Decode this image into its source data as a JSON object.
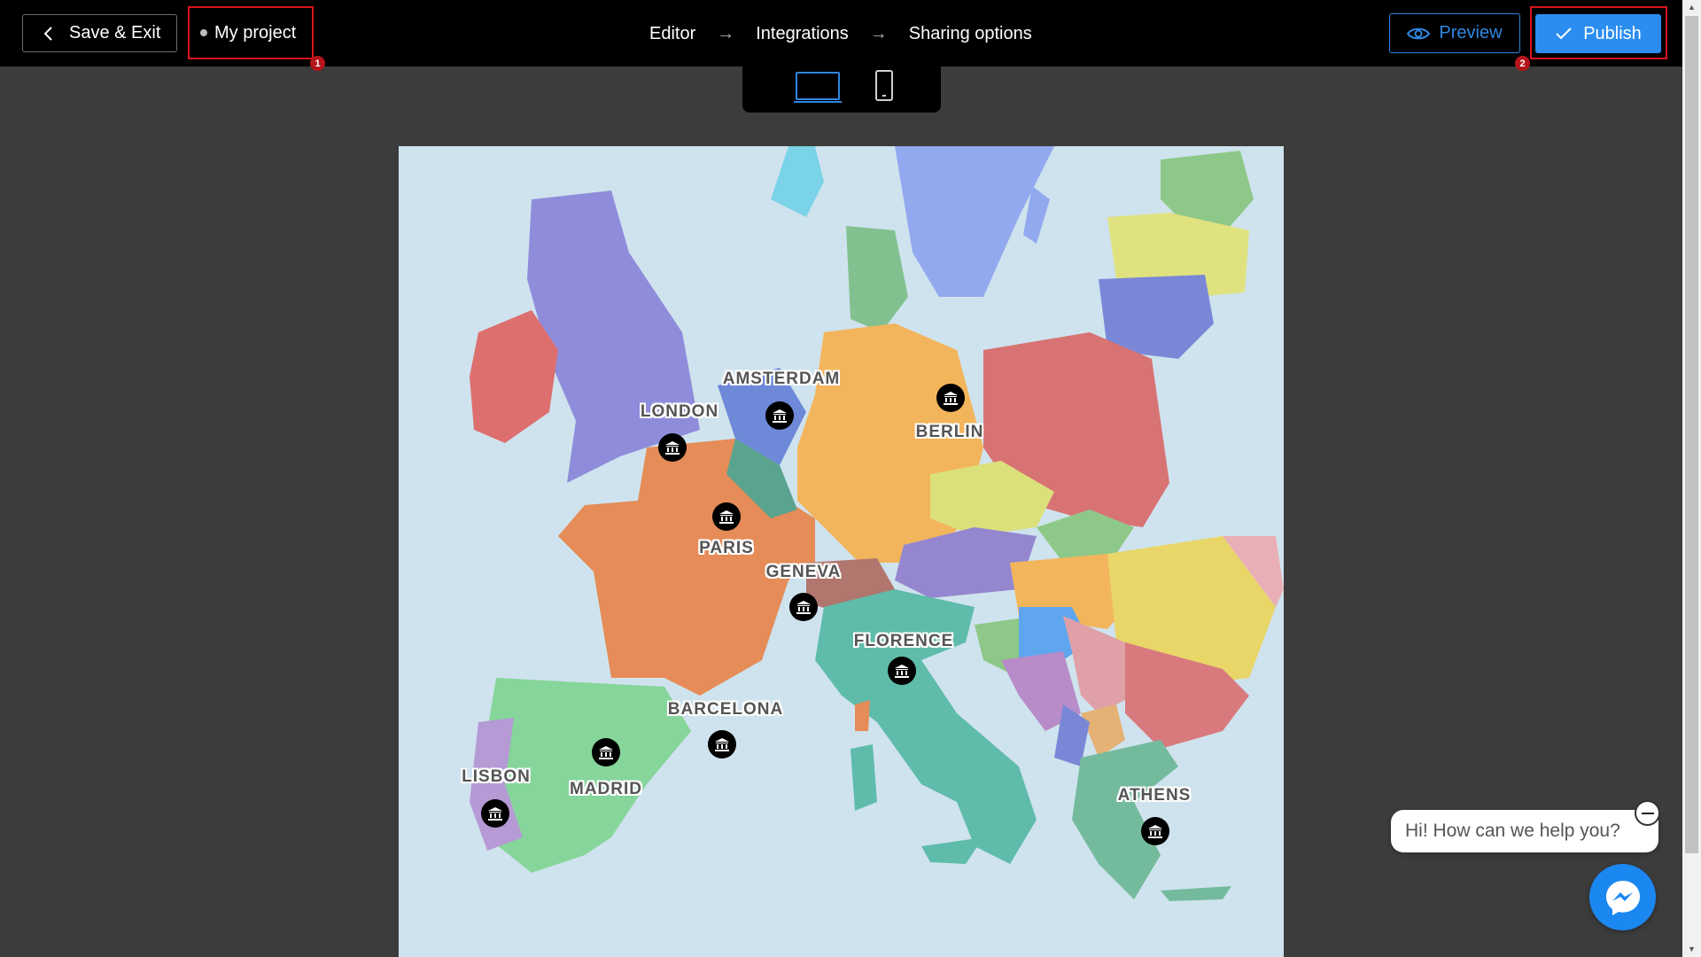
{
  "topbar": {
    "exit_label": "Save & Exit",
    "project_name": "My project",
    "badge_1": "1",
    "badge_2": "2",
    "steps": [
      "Editor",
      "Integrations",
      "Sharing options"
    ],
    "step_arrow": "→",
    "preview_label": "Preview",
    "publish_label": "Publish"
  },
  "device_switcher": {
    "desktop_icon": "desktop-icon",
    "mobile_icon": "mobile-icon",
    "selected": "desktop"
  },
  "map": {
    "marker_icon": "museum-icon",
    "cities": [
      {
        "name": "AMSTERDAM"
      },
      {
        "name": "LONDON"
      },
      {
        "name": "BERLIN"
      },
      {
        "name": "PARIS"
      },
      {
        "name": "GENEVA"
      },
      {
        "name": "FLORENCE"
      },
      {
        "name": "BARCELONA"
      },
      {
        "name": "MADRID"
      },
      {
        "name": "LISBON"
      },
      {
        "name": "ATHENS"
      }
    ]
  },
  "chat": {
    "greeting": "Hi! How can we help you?",
    "launcher_icon": "messenger-icon",
    "close_icon": "minus-icon"
  },
  "colors": {
    "accent": "#2b8df0",
    "highlight": "#d9141c",
    "water": "#cfe3ee"
  }
}
